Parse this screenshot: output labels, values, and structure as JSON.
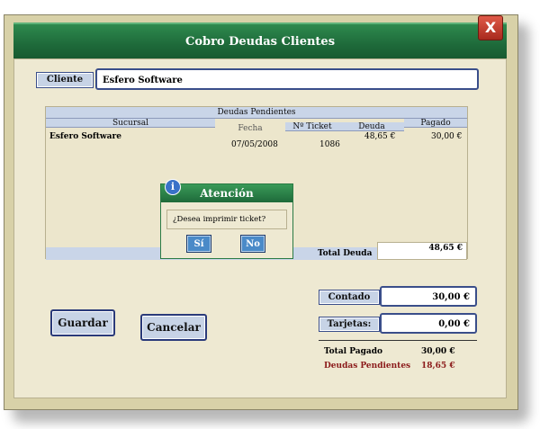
{
  "window": {
    "title": "Cobro Deudas Clientes",
    "close_icon": "close-icon"
  },
  "cliente": {
    "label": "Cliente",
    "value": "Esfero Software"
  },
  "deudas": {
    "title": "Deudas Pendientes",
    "headers": {
      "sucursal": "Sucursal",
      "fecha": "Fecha",
      "ticket": "Nº Ticket",
      "deuda": "Deuda",
      "pagado": "Pagado"
    },
    "rows": [
      {
        "sucursal": "Esfero Software",
        "fecha": "07/05/2008",
        "ticket": "1086",
        "deuda": "48,65 €",
        "pagado": "30,00 €"
      }
    ],
    "total_label": "Total Deuda",
    "total_value": "48,65 €"
  },
  "dialog": {
    "title": "Atención",
    "message": "¿Desea imprimir ticket?",
    "yes": "Sí",
    "no": "No",
    "icon": "info-icon"
  },
  "pago": {
    "contado_label": "Contado",
    "contado_value": "30,00 €",
    "tarjetas_label": "Tarjetas:",
    "tarjetas_value": "0,00 €",
    "total_pagado_label": "Total Pagado",
    "total_pagado_value": "30,00 €",
    "deudas_pendientes_label": "Deudas Pendientes",
    "deudas_pendientes_value": "18,65 €"
  },
  "actions": {
    "guardar": "Guardar",
    "cancelar": "Cancelar"
  },
  "colors": {
    "accent": "#1e6a3a",
    "pending": "#8b1a1a",
    "button": "#c7d3e6"
  }
}
